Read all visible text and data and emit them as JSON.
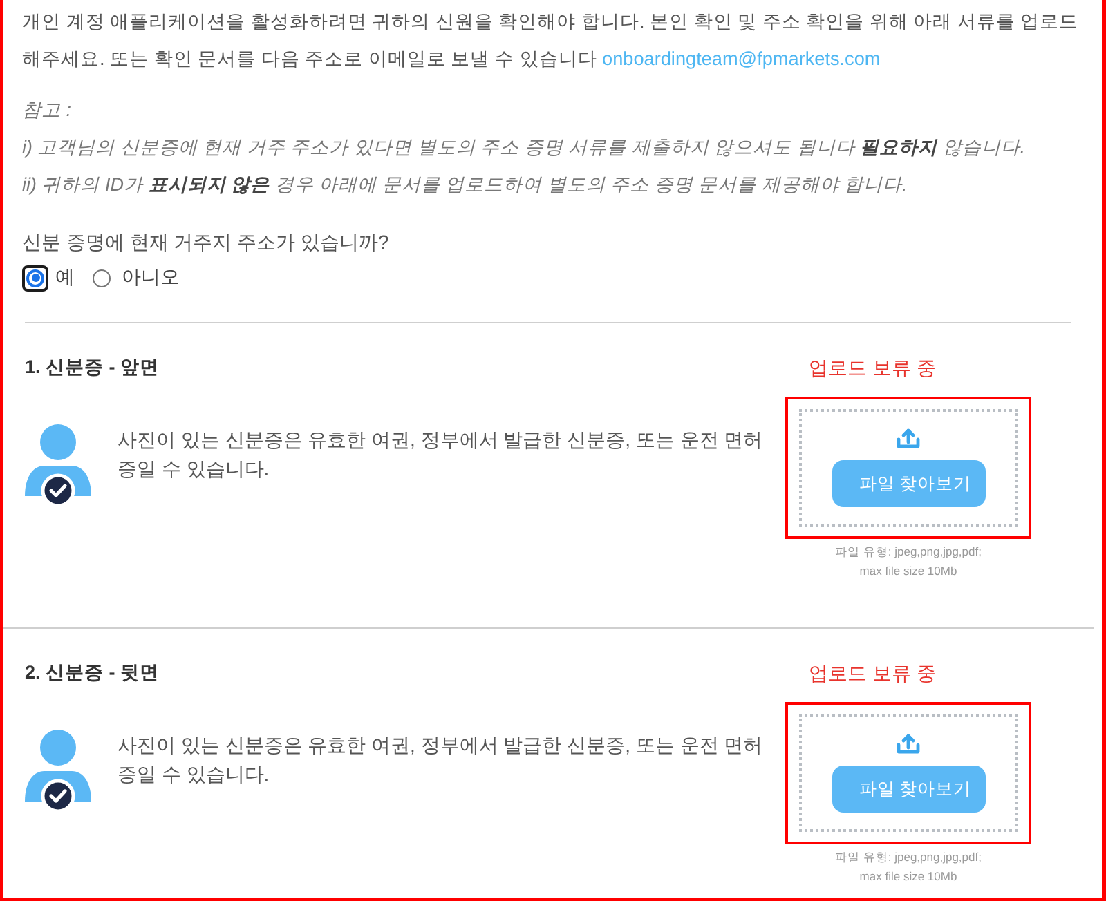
{
  "intro": {
    "text": "개인 계정 애플리케이션을 활성화하려면 귀하의 신원을 확인해야 합니다. 본인 확인 및 주소 확인을 위해 아래 서류를 업로드해주세요. 또는 확인 문서를 다음 주소로 이메일로 보낼 수 있습니다",
    "email": "onboardingteam@fpmarkets.com"
  },
  "notes": {
    "heading": "참고 :",
    "items": [
      "i) 고객님의 신분증에 현재 거주 주소가 있다면 별도의 주소 증명 서류를 제출하지 않으셔도 됩니다 **필요하지** 않습니다.",
      "ii) 귀하의 ID가 **표시되지 않은** 경우 아래에 문서를 업로드하여 별도의 주소 증명 문서를 제공해야 합니다."
    ]
  },
  "question": {
    "label": "신분 증명에 현재 거주지 주소가 있습니까?",
    "options": [
      {
        "label": "예",
        "selected": true,
        "focused": true
      },
      {
        "label": "아니오",
        "selected": false,
        "focused": false
      }
    ]
  },
  "documents": [
    {
      "title": "1. 신분증 - 앞면",
      "status": "업로드 보류 중",
      "description": "사진이 있는 신분증은 유효한 여권, 정부에서 발급한 신분증, 또는 운전 면허증일 수 있습니다.",
      "button": "파일 찾아보기",
      "file_types": "파일 유형: jpeg,png,jpg,pdf;",
      "max_size": "max file size 10Mb",
      "highlighted": true
    },
    {
      "title": "2. 신분증 - 뒷면",
      "status": "업로드 보류 중",
      "description": "사진이 있는 신분증은 유효한 여권, 정부에서 발급한 신분증, 또는 운전 면허증일 수 있습니다.",
      "button": "파일 찾아보기",
      "file_types": "파일 유형: jpeg,png,jpg,pdf;",
      "max_size": "max file size 10Mb",
      "highlighted": true
    }
  ]
}
